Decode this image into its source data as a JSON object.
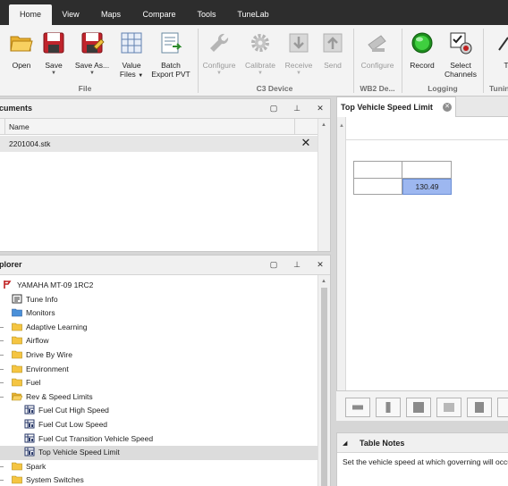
{
  "menu": {
    "tabs": [
      {
        "label": "Home",
        "active": true
      },
      {
        "label": "View"
      },
      {
        "label": "Maps"
      },
      {
        "label": "Compare"
      },
      {
        "label": "Tools"
      },
      {
        "label": "TuneLab"
      }
    ]
  },
  "ribbon": {
    "open": "Open",
    "save": "Save",
    "save_as": "Save As...",
    "value_files": "Value Files",
    "batch_export": "Batch Export PVT",
    "c3_configure": "Configure",
    "calibrate": "Calibrate",
    "receive": "Receive",
    "send": "Send",
    "wb2_configure": "Configure",
    "record": "Record",
    "select_channels": "Select Channels",
    "tuni_partial": "T",
    "groups": {
      "file": "File",
      "c3_device": "C3 Device",
      "wb2": "WB2 De...",
      "logging": "Logging",
      "tuning_partial": "Tunin"
    }
  },
  "documents_panel": {
    "title": "cuments",
    "column_name": "Name",
    "files": [
      "2201004.stk"
    ]
  },
  "explorer_panel": {
    "title": "plorer",
    "tree": [
      {
        "label": "YAMAHA MT-09 1RC2",
        "icon": "bike-icon",
        "indent": 0
      },
      {
        "label": "Tune Info",
        "icon": "info-icon",
        "indent": 1
      },
      {
        "label": "Monitors",
        "icon": "folder-blue-icon",
        "indent": 1
      },
      {
        "label": "Adaptive Learning",
        "icon": "folder-icon",
        "indent": 1
      },
      {
        "label": "Airflow",
        "icon": "folder-icon",
        "indent": 1
      },
      {
        "label": "Drive By Wire",
        "icon": "folder-icon",
        "indent": 1
      },
      {
        "label": "Environment",
        "icon": "folder-icon",
        "indent": 1
      },
      {
        "label": "Fuel",
        "icon": "folder-icon",
        "indent": 1
      },
      {
        "label": "Rev & Speed Limits",
        "icon": "folder-open-icon",
        "indent": 1
      },
      {
        "label": "Fuel Cut High Speed",
        "icon": "table-icon",
        "indent": 2
      },
      {
        "label": "Fuel Cut Low Speed",
        "icon": "table-icon",
        "indent": 2
      },
      {
        "label": "Fuel Cut Transition Vehicle Speed",
        "icon": "table-icon",
        "indent": 2
      },
      {
        "label": "Top Vehicle Speed Limit",
        "icon": "table-icon",
        "indent": 2,
        "selected": true
      },
      {
        "label": "Spark",
        "icon": "folder-icon",
        "indent": 1
      },
      {
        "label": "System Switches",
        "icon": "folder-icon",
        "indent": 1
      }
    ]
  },
  "editor": {
    "tab_title": "Top Vehicle Speed Limit",
    "value": "130.49"
  },
  "table_notes": {
    "title": "Table Notes",
    "text": "Set the vehicle speed at which governing will occu"
  },
  "colors": {
    "menubar": "#2d2d2d",
    "ribbon": "#f3f3f3",
    "selected_cell": "#9db7f0",
    "folder": "#f5c542",
    "record_green": "#2fbf2f"
  }
}
